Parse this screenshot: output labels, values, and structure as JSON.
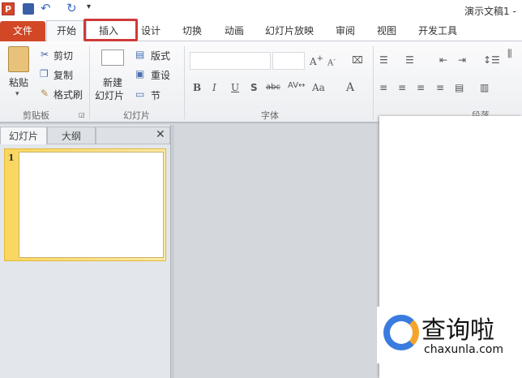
{
  "title": "演示文稿1 -",
  "quick_access": {
    "icons": [
      "powerpoint-logo-icon",
      "save-icon",
      "undo-icon",
      "redo-icon",
      "customize-icon"
    ]
  },
  "tabs": [
    {
      "label": "文件"
    },
    {
      "label": "开始"
    },
    {
      "label": "插入"
    },
    {
      "label": "设计"
    },
    {
      "label": "切换"
    },
    {
      "label": "动画"
    },
    {
      "label": "幻灯片放映"
    },
    {
      "label": "审阅"
    },
    {
      "label": "视图"
    },
    {
      "label": "开发工具"
    }
  ],
  "highlight_color": "#d03a3a",
  "ribbon": {
    "clipboard": {
      "label": "剪贴板",
      "paste": "粘贴",
      "cut": "剪切",
      "copy": "复制",
      "format_painter": "格式刷"
    },
    "slides": {
      "label": "幻灯片",
      "new_slide_1": "新建",
      "new_slide_2": "幻灯片",
      "layout": "版式",
      "reset": "重设",
      "section": "节"
    },
    "font": {
      "label": "字体",
      "font_name": "",
      "font_size": ""
    },
    "paragraph": {
      "label": "段落"
    }
  },
  "pane": {
    "tabs": [
      "幻灯片",
      "大纲"
    ],
    "close": "✕",
    "slide_number": "1"
  },
  "watermark": {
    "text": "查询啦",
    "domain": "chaxunla.com"
  }
}
